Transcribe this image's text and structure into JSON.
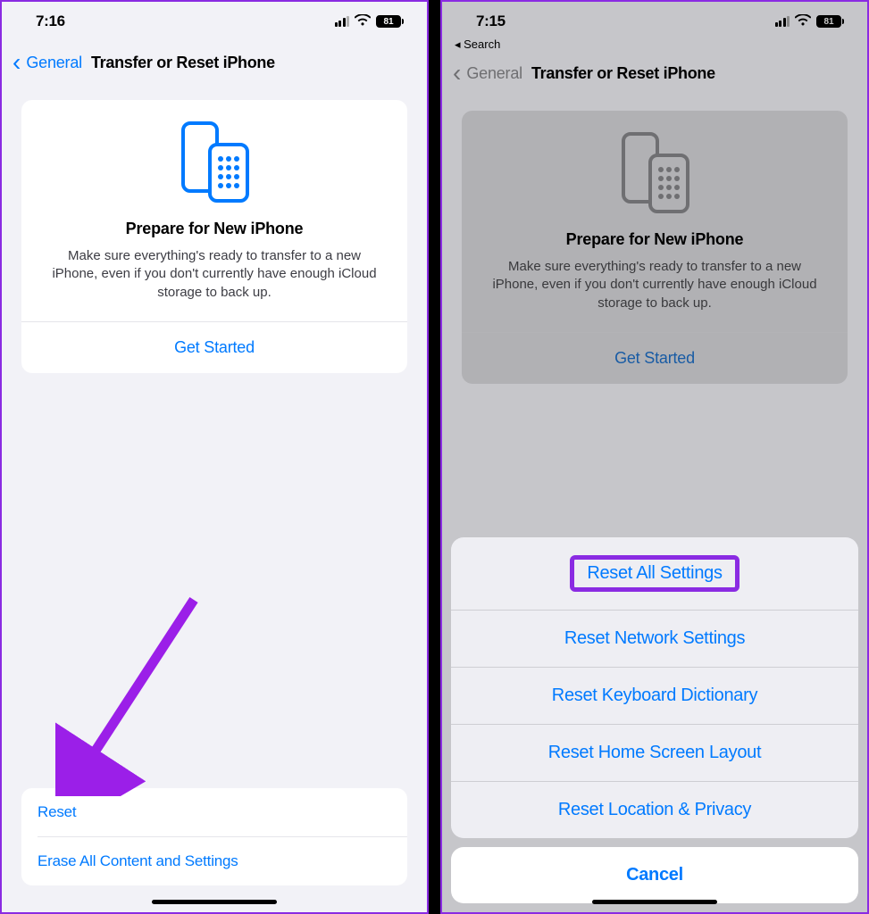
{
  "left": {
    "status": {
      "time": "7:16",
      "battery": "81"
    },
    "nav": {
      "back": "General",
      "title": "Transfer or Reset iPhone"
    },
    "card": {
      "title": "Prepare for New iPhone",
      "desc": "Make sure everything's ready to transfer to a new iPhone, even if you don't currently have enough iCloud storage to back up.",
      "action": "Get Started"
    },
    "list": {
      "reset": "Reset",
      "erase": "Erase All Content and Settings"
    },
    "icon_color": "#007aff"
  },
  "right": {
    "status": {
      "time": "7:15",
      "battery": "81"
    },
    "back_search": "◂ Search",
    "nav": {
      "back": "General",
      "title": "Transfer or Reset iPhone"
    },
    "card": {
      "title": "Prepare for New iPhone",
      "desc": "Make sure everything's ready to transfer to a new iPhone, even if you don't currently have enough iCloud storage to back up.",
      "action": "Get Started"
    },
    "sheet": {
      "items": [
        "Reset All Settings",
        "Reset Network Settings",
        "Reset Keyboard Dictionary",
        "Reset Home Screen Layout",
        "Reset Location & Privacy"
      ],
      "cancel": "Cancel"
    },
    "icon_color": "#8e8e93"
  },
  "annotation": {
    "arrow_color": "#9b1fe8",
    "highlight_color": "#8a2be2"
  }
}
